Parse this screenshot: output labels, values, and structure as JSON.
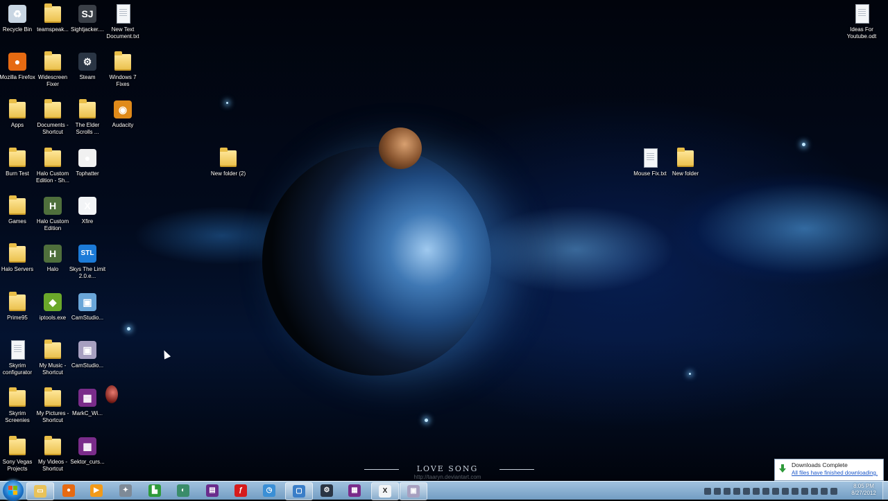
{
  "wallpaper": {
    "title": "LOVE SONG",
    "credit": "http://taaryn.deviantart.com"
  },
  "desktop_icons": [
    {
      "label": "Recycle Bin",
      "icon": "recycle-bin-icon",
      "kind": "app",
      "color": "#c9d6e3",
      "glyph": "♻"
    },
    {
      "label": "teamspeak...",
      "icon": "folder-icon",
      "kind": "folder"
    },
    {
      "label": "Sightjacker....",
      "icon": "sightjacker-icon",
      "kind": "app",
      "color": "#3a3f47",
      "glyph": "SJ"
    },
    {
      "label": "New Text Document.txt",
      "icon": "text-file-icon",
      "kind": "doc"
    },
    {
      "label": "Mozilla Firefox",
      "icon": "firefox-icon",
      "kind": "app",
      "color": "#e66a12",
      "glyph": "●"
    },
    {
      "label": "Widescreen Fixer",
      "icon": "folder-icon",
      "kind": "folder"
    },
    {
      "label": "Steam",
      "icon": "steam-icon",
      "kind": "app",
      "color": "#2a3544",
      "glyph": "⚙"
    },
    {
      "label": "Windows 7 Fixes",
      "icon": "folder-icon",
      "kind": "folder"
    },
    {
      "label": "Apps",
      "icon": "folder-icon",
      "kind": "folder"
    },
    {
      "label": "Documents - Shortcut",
      "icon": "folder-icon",
      "kind": "folder"
    },
    {
      "label": "The Elder Scrolls ...",
      "icon": "folder-icon",
      "kind": "folder"
    },
    {
      "label": "Audacity",
      "icon": "audacity-icon",
      "kind": "app",
      "color": "#e08a1a",
      "glyph": "◉"
    },
    {
      "label": "Burn Test",
      "icon": "folder-icon",
      "kind": "folder"
    },
    {
      "label": "Halo Custom Edition - Sh...",
      "icon": "folder-icon",
      "kind": "folder"
    },
    {
      "label": "Tophatter",
      "icon": "tophatter-icon",
      "kind": "app",
      "color": "#f1f1f1",
      "glyph": "●"
    },
    {
      "label": "Games",
      "icon": "folder-icon",
      "kind": "folder"
    },
    {
      "label": "Halo Custom Edition",
      "icon": "halo-icon",
      "kind": "app",
      "color": "#4f6f3c",
      "glyph": "H"
    },
    {
      "label": "Xfire",
      "icon": "xfire-icon",
      "kind": "app",
      "color": "#f2f4f6",
      "glyph": "X"
    },
    {
      "label": "Halo Servers",
      "icon": "folder-icon",
      "kind": "folder"
    },
    {
      "label": "Halo",
      "icon": "halo-icon",
      "kind": "app",
      "color": "#4f6f3c",
      "glyph": "H"
    },
    {
      "label": "Skys The Limit 2.0.e...",
      "icon": "stl-icon",
      "kind": "app",
      "color": "#1c7bd8",
      "glyph": "STL"
    },
    {
      "label": "Prime95",
      "icon": "folder-icon",
      "kind": "folder"
    },
    {
      "label": "iptools.exe",
      "icon": "iptools-icon",
      "kind": "app",
      "color": "#6aa82a",
      "glyph": "◆"
    },
    {
      "label": "CamStudio...",
      "icon": "camstudio-icon",
      "kind": "app",
      "color": "#6aa6d8",
      "glyph": "▣"
    },
    {
      "label": "Skyrim configurator",
      "icon": "file-icon",
      "kind": "doc"
    },
    {
      "label": "My Music - Shortcut",
      "icon": "folder-icon",
      "kind": "folder"
    },
    {
      "label": "CamStudio...",
      "icon": "camstudio-icon",
      "kind": "app",
      "color": "#a7a0c0",
      "glyph": "▣"
    },
    {
      "label": "Skyrim Screenies",
      "icon": "folder-icon",
      "kind": "folder"
    },
    {
      "label": "My Pictures - Shortcut",
      "icon": "folder-icon",
      "kind": "folder"
    },
    {
      "label": "MarkC_Wi...",
      "icon": "winrar-icon",
      "kind": "app",
      "color": "#7a2c8a",
      "glyph": "▦"
    },
    {
      "label": "Sony Vegas Projects",
      "icon": "folder-icon",
      "kind": "folder"
    },
    {
      "label": "My Videos - Shortcut",
      "icon": "folder-icon",
      "kind": "folder"
    },
    {
      "label": "Sektor_curs...",
      "icon": "winrar-icon",
      "kind": "app",
      "color": "#7a2c8a",
      "glyph": "▦"
    },
    {
      "label": "New folder (2)",
      "icon": "folder-icon",
      "kind": "folder"
    },
    {
      "label": "Mouse Fix.txt",
      "icon": "text-file-icon",
      "kind": "doc"
    },
    {
      "label": "New folder",
      "icon": "folder-icon",
      "kind": "folder"
    },
    {
      "label": "Ideas For Youtube.odt",
      "icon": "odt-file-icon",
      "kind": "doc"
    }
  ],
  "taskbar": {
    "start_label": "Start",
    "pinned": [
      {
        "icon": "explorer-icon",
        "glyph": "▭",
        "color": "#e8c25a",
        "active": true
      },
      {
        "icon": "firefox-icon",
        "glyph": "●",
        "color": "#e66a12",
        "active": false
      },
      {
        "icon": "media-player-icon",
        "glyph": "▶",
        "color": "#f29a18",
        "active": false
      },
      {
        "icon": "tool-icon",
        "glyph": "✦",
        "color": "#7e8a97",
        "active": false
      },
      {
        "icon": "chart-app-icon",
        "glyph": "▙",
        "color": "#2e9a3a",
        "active": false
      },
      {
        "icon": "audio-app-icon",
        "glyph": "◐",
        "color": "#3a8c6a",
        "active": false
      },
      {
        "icon": "vegas-icon",
        "glyph": "▤",
        "color": "#6a2c8c",
        "active": false
      },
      {
        "icon": "flash-icon",
        "glyph": "ƒ",
        "color": "#d61c1c",
        "active": false
      },
      {
        "icon": "clock-app-icon",
        "glyph": "◷",
        "color": "#3a8fd6",
        "active": false
      },
      {
        "icon": "monitor-app-icon",
        "glyph": "▢",
        "color": "#3a7ec8",
        "active": true
      },
      {
        "icon": "steam-icon",
        "glyph": "⚙",
        "color": "#2a3544",
        "active": false
      },
      {
        "icon": "winrar-icon",
        "glyph": "▦",
        "color": "#7a2c8a",
        "active": false
      },
      {
        "icon": "xfire-icon",
        "glyph": "X",
        "color": "#f2f4f6",
        "active": true
      },
      {
        "icon": "camstudio-icon",
        "glyph": "▣",
        "color": "#a7a0c0",
        "active": true
      }
    ],
    "clock_time": "8:05 PM",
    "clock_date": "8/27/2012"
  },
  "notification": {
    "title": "Downloads Complete",
    "link": "All files have finished downloading."
  }
}
